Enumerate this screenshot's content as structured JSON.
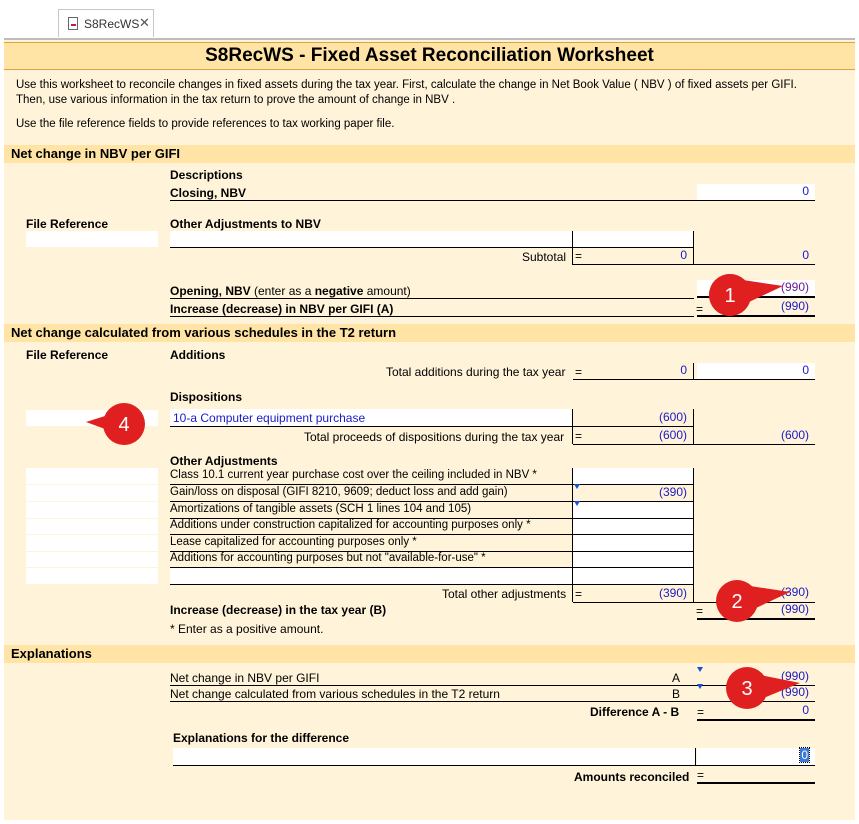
{
  "tab": {
    "label": "S8RecWS",
    "close": "✕"
  },
  "title": "S8RecWS - Fixed Asset Reconciliation Worksheet",
  "intro": {
    "line1": "Use this worksheet to reconcile changes in fixed assets during the tax year. First, calculate the change in Net Book Value ( NBV ) of fixed assets per GIFI.",
    "line2": "Then, use various information in the tax return to prove the amount of change in NBV .",
    "line3": "Use the file reference fields to provide references to tax working paper file."
  },
  "sec1": {
    "header": "Net change in NBV per GIFI",
    "descriptions": "Descriptions",
    "closing_label": "Closing, NBV",
    "closing_value": "0",
    "file_reference": "File Reference",
    "other_adj": "Other Adjustments to NBV",
    "subtotal_label": "Subtotal",
    "subtotal_eq": "=",
    "subtotal_mid": "0",
    "subtotal_right": "0",
    "opening_label_bold": "Opening, NBV",
    "opening_label_rest": " (enter as a ",
    "opening_label_neg": "negative",
    "opening_label_end": " amount)",
    "opening_value": "(990)",
    "increase_label": "Increase (decrease) in NBV per GIFI (A)",
    "increase_eq": "=",
    "increase_value": "(990)"
  },
  "sec2": {
    "header": "Net change calculated from various schedules in the T2 return",
    "file_reference": "File Reference",
    "additions": "Additions",
    "total_additions_label": "Total additions during the tax year",
    "total_additions_eq": "=",
    "total_additions_mid": "0",
    "total_additions_right": "0",
    "dispositions": "Dispositions",
    "disp_item_label": "10-a Computer equipment purchase",
    "disp_item_value": "(600)",
    "total_proceeds_label": "Total proceeds of dispositions during the tax year",
    "total_proceeds_eq": "=",
    "total_proceeds_mid": "(600)",
    "total_proceeds_right": "(600)",
    "other_adjustments": "Other Adjustments",
    "adj_items": [
      {
        "label": "Class 10.1 current year purchase cost over the ceiling included in NBV *",
        "value": ""
      },
      {
        "label": "Gain/loss on disposal (GIFI 8210, 9609; deduct loss and add gain)",
        "value": "(390)"
      },
      {
        "label": "Amortizations of tangible assets (SCH 1 lines 104 and 105)",
        "value": ""
      },
      {
        "label": "Additions under construction capitalized for accounting purposes only *",
        "value": ""
      },
      {
        "label": "Lease capitalized for accounting purposes only *",
        "value": ""
      },
      {
        "label": "Additions for accounting purposes but not \"available-for-use\" *",
        "value": ""
      }
    ],
    "total_other_label": "Total other adjustments",
    "total_other_eq": "=",
    "total_other_mid": "(390)",
    "total_other_right": "(390)",
    "increase_label": "Increase (decrease) in the tax year (B)",
    "increase_eq": "=",
    "increase_value": "(990)",
    "footnote": "* Enter as a positive amount."
  },
  "sec3": {
    "header": "Explanations",
    "row_a_label": "Net change in NBV per GIFI",
    "row_a_letter": "A",
    "row_a_value": "(990)",
    "row_b_label": "Net change calculated from various schedules in the T2 return",
    "row_b_letter": "B",
    "row_b_value": "(990)",
    "diff_label": "Difference A - B",
    "diff_eq": "=",
    "diff_value": "0",
    "expl_label": "Explanations for the difference",
    "expl_value": "0",
    "reconciled_label": "Amounts reconciled",
    "reconciled_eq": "="
  },
  "callouts": [
    "1",
    "2",
    "3",
    "4"
  ],
  "colors": {
    "accent": "#ffe4a6",
    "sheet": "#fff3d9",
    "value_text": "#1a1ac8",
    "callout": "#e02020"
  }
}
